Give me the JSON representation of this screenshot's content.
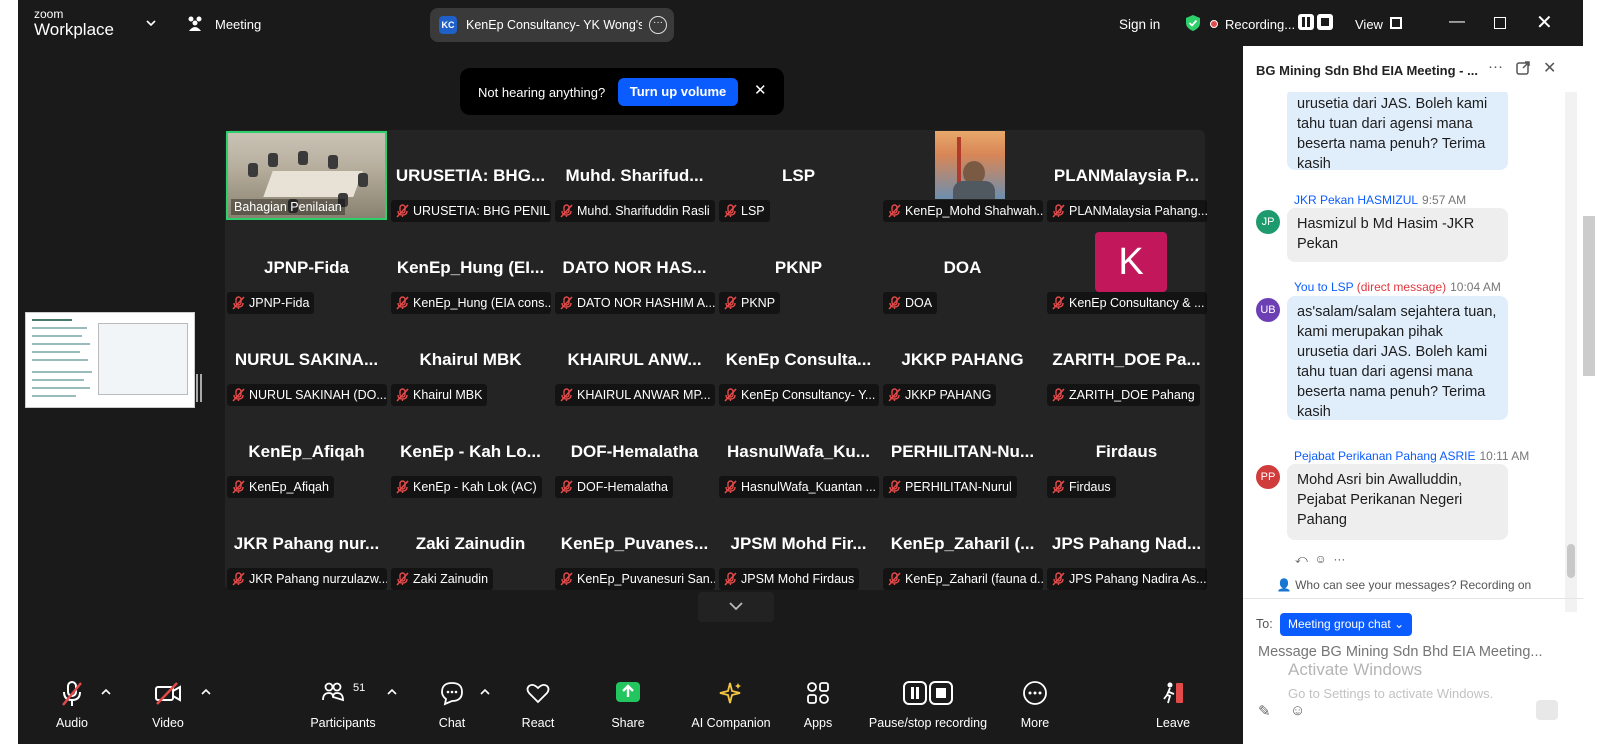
{
  "titlebar": {
    "logo_line1": "zoom",
    "logo_line2": "Workplace",
    "meeting_label": "Meeting",
    "meeting_chip_initials": "KC",
    "meeting_chip_text": "KenEp Consultancy- YK Wong's s",
    "sign_in": "Sign in",
    "recording_label": "Recording...",
    "view_label": "View"
  },
  "banner": {
    "message": "Not hearing anything?",
    "button": "Turn up volume"
  },
  "gallery": {
    "tiles": [
      {
        "name": "",
        "label": "Bahagian Penilaian",
        "video": true
      },
      {
        "name": "URUSETIA: BHG...",
        "label": "URUSETIA: BHG PENIL..."
      },
      {
        "name": "Muhd. Sharifud...",
        "label": "Muhd. Sharifuddin Rasli"
      },
      {
        "name": "LSP",
        "label": "LSP"
      },
      {
        "name": "",
        "label": "KenEp_Mohd Shahwah...",
        "photo": true
      },
      {
        "name": "PLANMalaysia P...",
        "label": "PLANMalaysia Pahang..."
      },
      {
        "name": "JPNP-Fida",
        "label": "JPNP-Fida"
      },
      {
        "name": "KenEp_Hung (EI...",
        "label": "KenEp_Hung (EIA cons..."
      },
      {
        "name": "DATO NOR HAS...",
        "label": "DATO NOR HASHIM A..."
      },
      {
        "name": "PKNP",
        "label": "PKNP"
      },
      {
        "name": "DOA",
        "label": "DOA"
      },
      {
        "name": "",
        "label": "KenEp Consultancy & ...",
        "avatar": "K"
      },
      {
        "name": "NURUL SAKINA...",
        "label": "NURUL SAKINAH (DO..."
      },
      {
        "name": "Khairul MBK",
        "label": "Khairul MBK"
      },
      {
        "name": "KHAIRUL ANW...",
        "label": "KHAIRUL ANWAR MP..."
      },
      {
        "name": "KenEp Consulta...",
        "label": "KenEp Consultancy- Y..."
      },
      {
        "name": "JKKP PAHANG",
        "label": "JKKP PAHANG"
      },
      {
        "name": "ZARITH_DOE Pa...",
        "label": "ZARITH_DOE Pahang"
      },
      {
        "name": "KenEp_Afiqah",
        "label": "KenEp_Afiqah"
      },
      {
        "name": "KenEp - Kah Lo...",
        "label": "KenEp - Kah Lok (AC)"
      },
      {
        "name": "DOF-Hemalatha",
        "label": "DOF-Hemalatha"
      },
      {
        "name": "HasnulWafa_Ku...",
        "label": "HasnulWafa_Kuantan ..."
      },
      {
        "name": "PERHILITAN-Nu...",
        "label": "PERHILITAN-Nurul"
      },
      {
        "name": "Firdaus",
        "label": "Firdaus"
      },
      {
        "name": "JKR Pahang nur...",
        "label": "JKR Pahang nurzulazw..."
      },
      {
        "name": "Zaki Zainudin",
        "label": "Zaki Zainudin"
      },
      {
        "name": "KenEp_Puvanes...",
        "label": "KenEp_Puvanesuri San..."
      },
      {
        "name": "JPSM Mohd Fir...",
        "label": "JPSM Mohd Firdaus"
      },
      {
        "name": "KenEp_Zaharil (...",
        "label": "KenEp_Zaharil (fauna d..."
      },
      {
        "name": "JPS Pahang Nad...",
        "label": "JPS Pahang Nadira As..."
      }
    ]
  },
  "toolbar": {
    "audio": "Audio",
    "video": "Video",
    "participants": "Participants",
    "participants_count": "51",
    "chat": "Chat",
    "react": "React",
    "share": "Share",
    "ai": "AI Companion",
    "apps": "Apps",
    "pause": "Pause/stop recording",
    "more": "More",
    "leave": "Leave"
  },
  "chat": {
    "title": "BG Mining Sdn Bhd EIA Meeting - ...",
    "messages": {
      "m0_text": "urusetia dari JAS. Boleh kami tahu tuan dari agensi mana beserta nama penuh? Terima kasih",
      "m1_sender": "JKR Pekan HASMIZUL",
      "m1_time": "9:57 AM",
      "m1_initials": "JP",
      "m1_text": "Hasmizul b Md Hasim -JKR Pekan",
      "m2_you": "You to",
      "m2_to": "LSP",
      "m2_dm": "(direct message)",
      "m2_time": "10:04 AM",
      "m2_initials": "UB",
      "m2_text": "as'salam/salam sejahtera tuan, kami merupakan pihak urusetia dari JAS. Boleh kami tahu tuan dari agensi mana beserta nama penuh? Terima kasih",
      "m3_sender": "Pejabat Perikanan Pahang ASRIE",
      "m3_time": "10:11 AM",
      "m3_initials": "PP",
      "m3_text": "Mohd Asri bin Awalluddin, Pejabat Perikanan Negeri Pahang"
    },
    "privacy": "Who can see your messages? Recording on",
    "to_label": "To:",
    "to_chip": "Meeting group chat",
    "input_placeholder": "Message BG Mining Sdn Bhd EIA Meeting...",
    "watermark1": "Activate Windows",
    "watermark2": "Go to Settings to activate Windows."
  },
  "colors": {
    "accent": "#0b5cff",
    "active_speaker": "#2ed06b",
    "mute_red": "#e34a4a",
    "k_avatar": "#c2185b"
  }
}
